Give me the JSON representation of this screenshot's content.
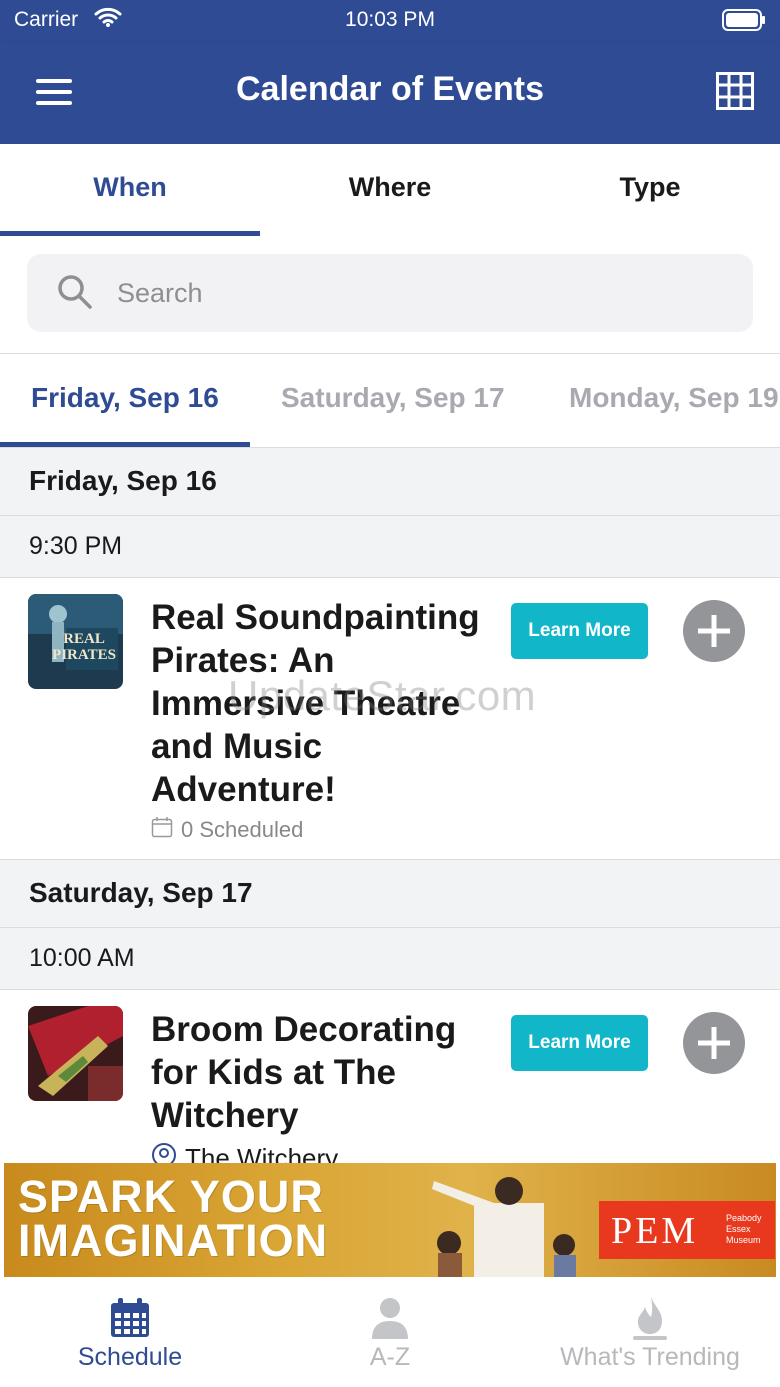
{
  "status_bar": {
    "carrier": "Carrier",
    "time": "10:03 PM"
  },
  "nav": {
    "title": "Calendar of Events",
    "menu_icon": "hamburger-icon",
    "grid_icon": "grid-icon"
  },
  "tabs": [
    {
      "label": "When",
      "active": true
    },
    {
      "label": "Where",
      "active": false
    },
    {
      "label": "Type",
      "active": false
    }
  ],
  "search": {
    "placeholder": "Search"
  },
  "date_tabs": [
    {
      "label": "Friday, Sep 16",
      "active": true
    },
    {
      "label": "Saturday, Sep 17",
      "active": false
    },
    {
      "label": "Monday, Sep 19",
      "active": false
    }
  ],
  "sections": [
    {
      "day": "Friday, Sep 16",
      "time": "9:30 PM",
      "event": {
        "title": "Real Soundpainting Pirates: An Immersive Theatre and Music Adventure!",
        "meta": "0 Scheduled",
        "learn_more": "Learn More"
      }
    },
    {
      "day": "Saturday, Sep 17",
      "time": "10:00 AM",
      "event": {
        "title": "Broom Decorating for Kids at The Witchery",
        "meta": "The Witchery",
        "learn_more": "Learn More"
      }
    }
  ],
  "thumb1_text": "REAL PIRATES",
  "watermark": "UpdateStar.com",
  "ad": {
    "headline_line1": "SPARK YOUR",
    "headline_line2": "IMAGINATION",
    "logo": "PEM",
    "logo_small": "Peabody Essex Museum"
  },
  "tabbar": [
    {
      "label": "Schedule",
      "icon": "calendar-icon",
      "active": true
    },
    {
      "label": "A-Z",
      "icon": "person-icon",
      "active": false
    },
    {
      "label": "What's Trending",
      "icon": "flame-icon",
      "active": false
    }
  ],
  "colors": {
    "brand": "#2f4b94",
    "accent": "#11b6c9",
    "add_button": "#939598",
    "ad_red": "#e8391f"
  }
}
